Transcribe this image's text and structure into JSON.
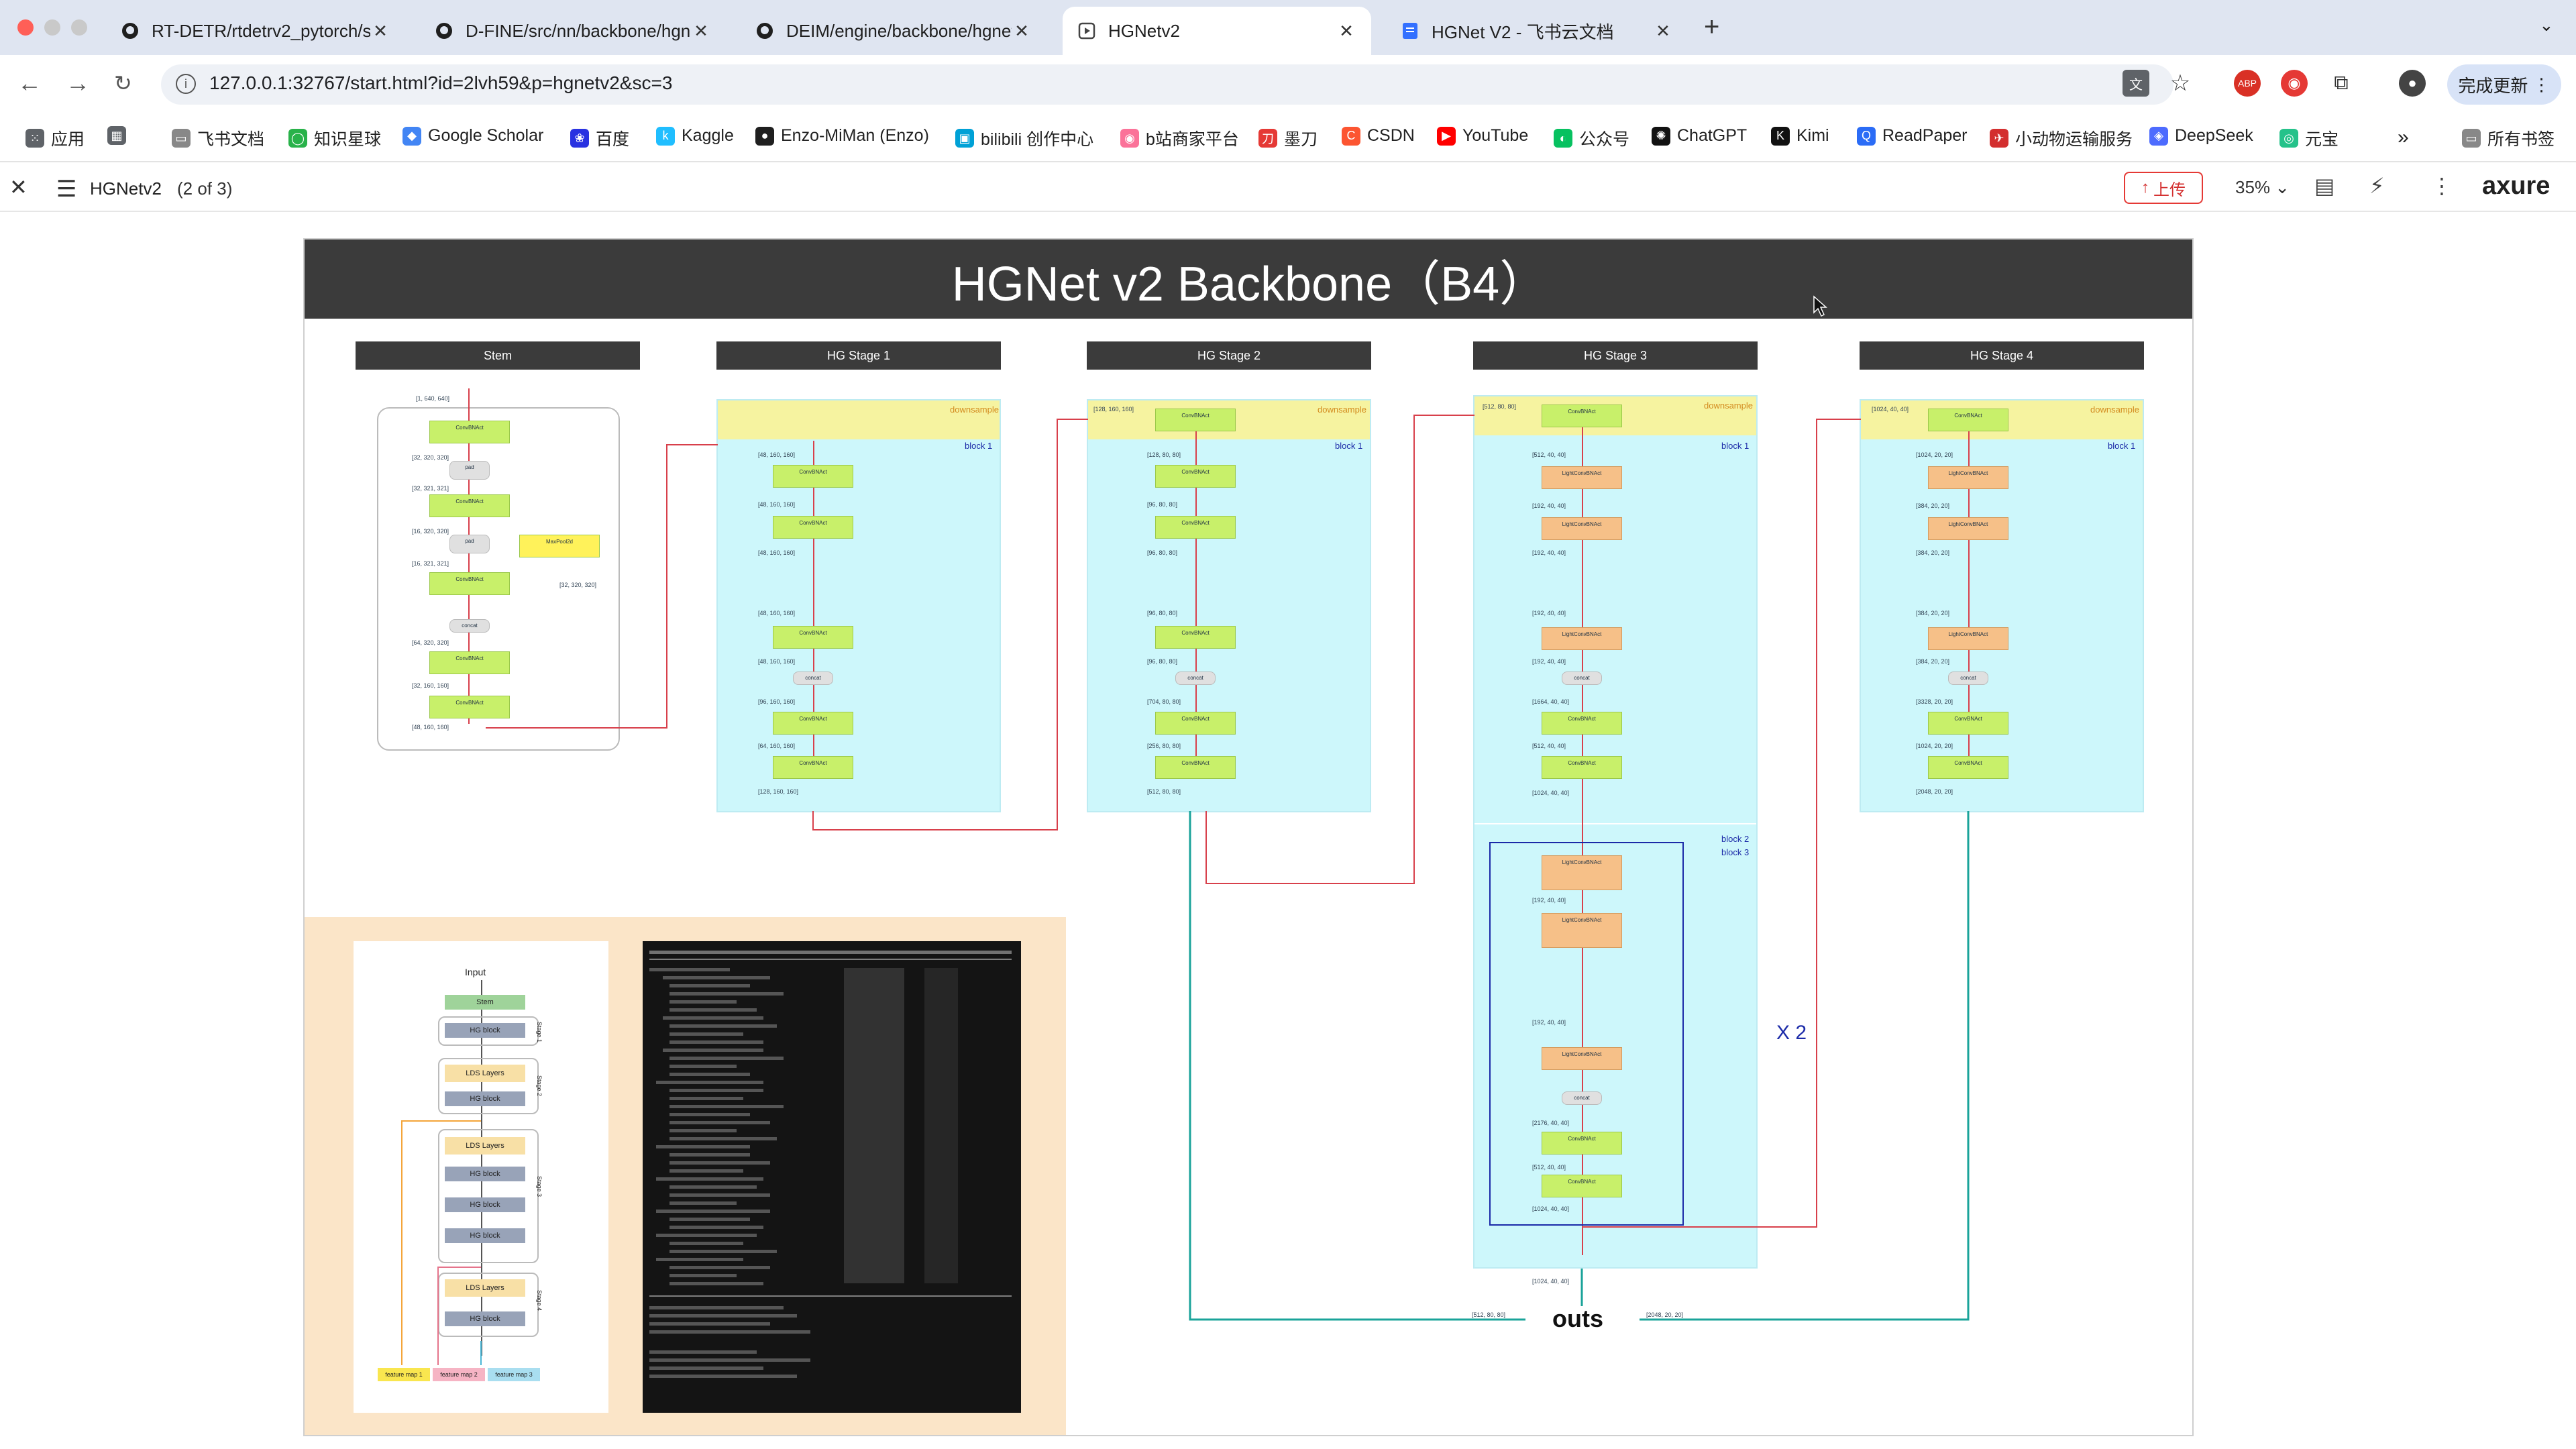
{
  "browser": {
    "tabs": [
      {
        "title": "RT-DETR/rtdetrv2_pytorch/s",
        "icon": "github-icon",
        "active": false
      },
      {
        "title": "D-FINE/src/nn/backbone/hgn",
        "icon": "github-icon",
        "active": false
      },
      {
        "title": "DEIM/engine/backbone/hgnet",
        "icon": "github-icon",
        "active": false
      },
      {
        "title": "HGNetv2",
        "icon": "axure-icon",
        "active": true
      },
      {
        "title": "HGNet V2 - 飞书云文档",
        "icon": "feishu-doc-icon",
        "active": false
      }
    ],
    "url": "127.0.0.1:32767/start.html?id=2lvh59&p=hgnetv2&sc=3",
    "update_label": "完成更新",
    "bookmarks": [
      "应用",
      "飞书文档",
      "知识星球",
      "Google Scholar",
      "百度",
      "Kaggle",
      "Enzo-MiMan (Enzo)",
      "bilibili 创作中心",
      "b站商家平台",
      "墨刀",
      "CSDN",
      "YouTube",
      "公众号",
      "ChatGPT",
      "Kimi",
      "ReadPaper",
      "小动物运输服务",
      "DeepSeek",
      "元宝"
    ],
    "all_bookmarks": "所有书签",
    "more": "»"
  },
  "axure": {
    "page_name": "HGNetv2",
    "page_count": "(2 of 3)",
    "upload_label": "上传",
    "zoom": "35%",
    "logo": "axure"
  },
  "slide": {
    "title": "HGNet v2 Backbone（B4）",
    "stages": [
      "Stem",
      "HG Stage 1",
      "HG Stage 2",
      "HG Stage 3",
      "HG Stage 4"
    ],
    "downsample_label": "downsample",
    "block1_label": "block 1",
    "block23_label": [
      "block 2",
      "block 3"
    ],
    "repeat_label": "X 2",
    "outs_label": "outs",
    "stem_sizes": [
      "[1, 640, 640]",
      "[32, 320, 320]",
      "[32, 321, 321]",
      "[16, 320, 320]",
      "[16, 321, 321]",
      "[32, 320, 320]",
      "[64, 320, 320]",
      "[32, 160, 160]",
      "[48, 160, 160]"
    ],
    "stage1_sizes": [
      "[48, 160, 160]",
      "[48, 160, 160]",
      "[48, 160, 160]",
      "[48, 160, 160]",
      "[48, 160, 160]",
      "[96, 160, 160]",
      "[64, 160, 160]",
      "[128, 160, 160]"
    ],
    "stage2_sizes": [
      "[128, 160, 160]",
      "[128, 80, 80]",
      "[96, 80, 80]",
      "[96, 80, 80]",
      "[96, 80, 80]",
      "[96, 80, 80]",
      "[704, 80, 80]",
      "[256, 80, 80]",
      "[512, 80, 80]"
    ],
    "stage3_sizes": [
      "[512, 80, 80]",
      "[512, 40, 40]",
      "[192, 40, 40]",
      "[192, 40, 40]",
      "[192, 40, 40]",
      "[192, 40, 40]",
      "[1664, 40, 40]",
      "[512, 40, 40]",
      "[1024, 40, 40]",
      "[192, 40, 40]",
      "[192, 40, 40]",
      "[2176, 40, 40]",
      "[512, 40, 40]",
      "[1024, 40, 40]",
      "[1024, 40, 40]"
    ],
    "stage4_sizes": [
      "[1024, 40, 40]",
      "[1024, 20, 20]",
      "[384, 20, 20]",
      "[384, 20, 20]",
      "[384, 20, 20]",
      "[384, 20, 20]",
      "[3328, 20, 20]",
      "[1024, 20, 20]",
      "[2048, 20, 20]"
    ],
    "out_sizes": [
      "[512, 80, 80]",
      "[2048, 20, 20]"
    ],
    "node_labels": {
      "convbn": "ConvBNAct",
      "lightconv": "LightConvBNAct",
      "concat": "concat",
      "pad": "pad",
      "maxpool": "MaxPool2d"
    },
    "mini_diagram": {
      "input": "Input",
      "stem": "Stem",
      "hg_block": "HG block",
      "lds": "LDS Layers",
      "stages": [
        "Stage 1",
        "Stage 2",
        "Stage 3",
        "Stage 4"
      ],
      "feature_maps": [
        "feature map 1",
        "feature map 2",
        "feature map 3"
      ]
    }
  }
}
